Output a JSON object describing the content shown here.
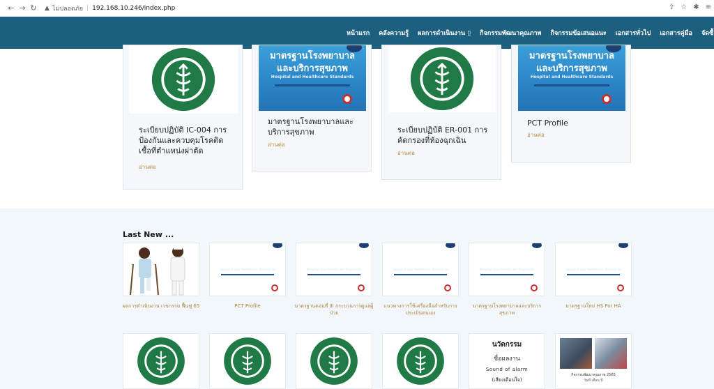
{
  "browser": {
    "insecure_label": "ไม่ปลอดภัย",
    "url": "192.168.10.246/index.php"
  },
  "nav": {
    "items": [
      "หน้าแรก",
      "คลังความรู้",
      "ผลการดำเนินงาน ▯",
      "กิจกรรมพัฒนาคุณภาพ",
      "กิจกรรมข้อเสนอแนะ",
      "เอกสารทั่วไป",
      "เอกสารคู่มือ",
      "จัดซื้อ"
    ]
  },
  "thumb_text": {
    "std_line1": "มาตรฐานโรงพยาบาล",
    "std_line2": "และบริการสุขภาพ",
    "std_sub": "Hospital and Healthcare Standards"
  },
  "cards": [
    {
      "title": "ระเบียบปฏิบัติ IC-004 การป้องกันและควบคุมโรคติดเชื้อที่ตำแหน่งผ่าตัด",
      "more": "อ่านต่อ"
    },
    {
      "title": "มาตรฐานโรงพยาบาลและบริการสุขภาพ",
      "more": "อ่านต่อ"
    },
    {
      "title": "ระเบียบปฏิบัติ ER-001 การคัดกรองที่ห้องฉุกเฉิน",
      "more": "อ่านต่อ"
    },
    {
      "title": "PCT Profile",
      "more": "อ่านต่อ"
    }
  ],
  "latest": {
    "heading": "Last New ...",
    "items": [
      {
        "caption": "ผลการดำเนินงาน เวชกรรม ฟื้นฟู 65"
      },
      {
        "caption": "PCT Profile"
      },
      {
        "caption": "มาตรฐานตอนที่ III กระบวนการดูแลผู้ป่วย"
      },
      {
        "caption": "แนวทางการใช้เครื่องมือสำหรับการประเมินตนเอง"
      },
      {
        "caption": "มาตรฐานโรงพยาบาลและบริการสุขภาพ"
      },
      {
        "caption": "มาตรฐานใหม่ HS For HA"
      }
    ]
  },
  "innovation": {
    "line1": "นวัตกรรม",
    "line2": "ชื่อผลงาน",
    "line3": "Sound of alarm",
    "line4": "(เสียงเตือนใจ)"
  },
  "photo_card": {
    "caption1": "กิจกรรมพัฒนาคุณภาพ 2565",
    "caption2": "วันที่ เดือน ปี"
  },
  "colors": {
    "nav_bg": "#1d5f7e",
    "link": "#c08a3c",
    "section_bg": "#f1f7fb",
    "seal_green": "#1f7a45"
  }
}
